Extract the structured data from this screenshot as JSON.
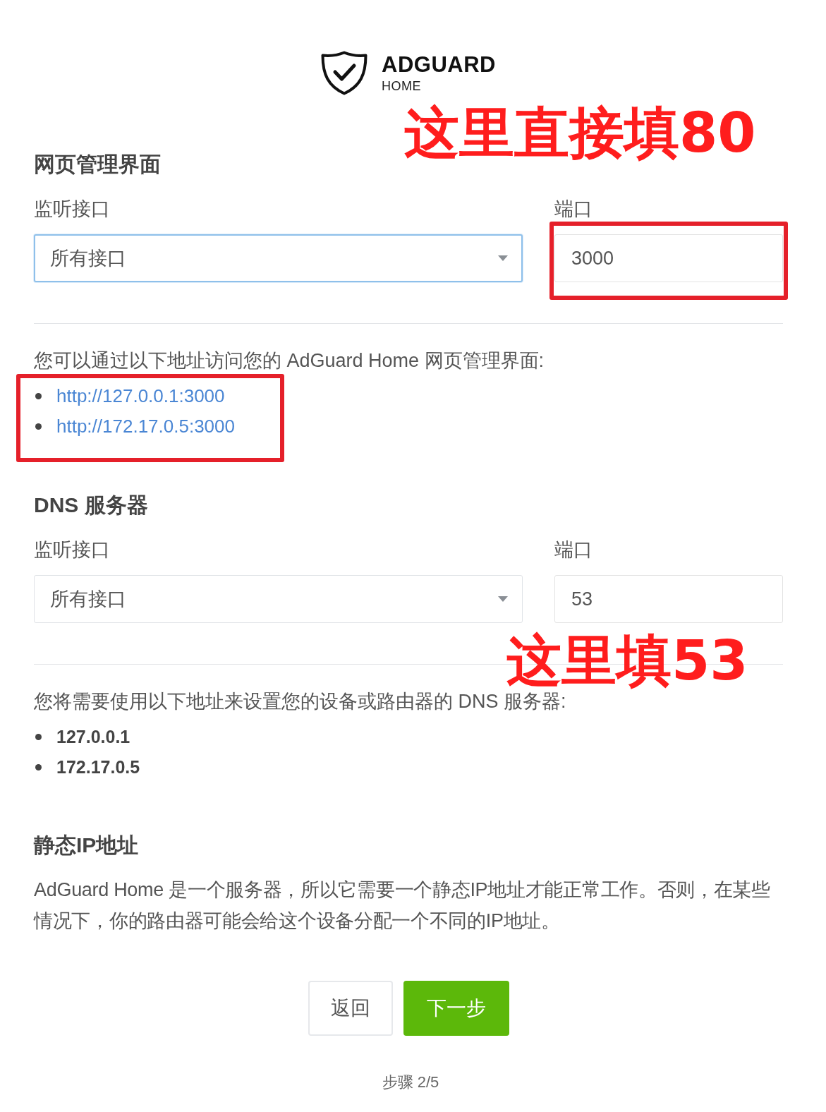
{
  "logo": {
    "title": "ADGUARD",
    "subtitle": "HOME"
  },
  "sections": [
    {
      "kind": "web_interface",
      "title": "网页管理界面",
      "annotation": "这里直接填80",
      "interface_label": "监听接口",
      "interface_value": "所有接口",
      "interface_focused": true,
      "port_label": "端口",
      "port_value": "3000",
      "port_highlighted": true,
      "note": "您可以通过以下地址访问您的 AdGuard Home 网页管理界面:",
      "addresses": [
        "http://127.0.0.1:3000",
        "http://172.17.0.5:3000"
      ],
      "addresses_highlighted": true
    },
    {
      "kind": "dns_server",
      "title": "DNS 服务器",
      "annotation": "这里填53",
      "interface_label": "监听接口",
      "interface_value": "所有接口",
      "interface_focused": false,
      "port_label": "端口",
      "port_value": "53",
      "port_highlighted": false,
      "note": "您将需要使用以下地址来设置您的设备或路由器的 DNS 服务器:",
      "addresses": [
        "127.0.0.1",
        "172.17.0.5"
      ],
      "addresses_highlighted": false
    },
    {
      "kind": "info",
      "title": "静态IP地址",
      "text": "AdGuard Home 是一个服务器，所以它需要一个静态IP地址才能正常工作。否则，在某些情况下，你的路由器可能会给这个设备分配一个不同的IP地址。"
    }
  ],
  "buttons": [
    {
      "label": "返回",
      "kind": "secondary"
    },
    {
      "label": "下一步",
      "kind": "primary"
    }
  ],
  "step": "步骤 2/5"
}
